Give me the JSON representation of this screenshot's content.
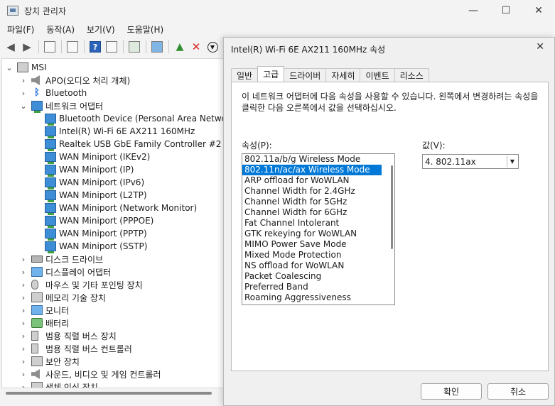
{
  "window": {
    "title": "장치 관리자",
    "minimize": "—",
    "maximize": "☐",
    "close": "✕"
  },
  "menu": [
    "파일(F)",
    "동작(A)",
    "보기(V)",
    "도움말(H)"
  ],
  "tree": {
    "root": "MSI",
    "categories": [
      {
        "label": "APO(오디오 처리 개체)",
        "icon": "speaker-icon"
      },
      {
        "label": "Bluetooth",
        "icon": "bluetooth-icon"
      },
      {
        "label": "네트워크 어댑터",
        "icon": "network-adapter-icon",
        "expanded": true
      }
    ],
    "network_adapters": [
      "Bluetooth Device (Personal Area Network)",
      "Intel(R) Wi-Fi 6E AX211 160MHz",
      "Realtek USB GbE Family Controller #2",
      "WAN Miniport (IKEv2)",
      "WAN Miniport (IP)",
      "WAN Miniport (IPv6)",
      "WAN Miniport (L2TP)",
      "WAN Miniport (Network Monitor)",
      "WAN Miniport (PPPOE)",
      "WAN Miniport (PPTP)",
      "WAN Miniport (SSTP)"
    ],
    "more_categories": [
      {
        "label": "디스크 드라이브",
        "icon": "disk-drive-icon"
      },
      {
        "label": "디스플레이 어댑터",
        "icon": "display-adapter-icon"
      },
      {
        "label": "마우스 및 기타 포인팅 장치",
        "icon": "mouse-icon"
      },
      {
        "label": "메모리 기술 장치",
        "icon": "memory-icon"
      },
      {
        "label": "모니터",
        "icon": "monitor-icon"
      },
      {
        "label": "배터리",
        "icon": "battery-icon"
      },
      {
        "label": "범용 직렬 버스 장치",
        "icon": "usb-device-icon"
      },
      {
        "label": "범용 직렬 버스 컨트롤러",
        "icon": "usb-controller-icon"
      },
      {
        "label": "보안 장치",
        "icon": "security-device-icon"
      },
      {
        "label": "사운드, 비디오 및 게임 컨트롤러",
        "icon": "sound-icon"
      },
      {
        "label": "생체 인식 장치",
        "icon": "biometric-icon"
      }
    ]
  },
  "dialog": {
    "title": "Intel(R) Wi-Fi 6E AX211 160MHz 속성",
    "close": "✕",
    "tabs": [
      "일반",
      "고급",
      "드라이버",
      "자세히",
      "이벤트",
      "리소스"
    ],
    "active_tab": "고급",
    "description": "이 네트워크 어댑터에 다음 속성을 사용할 수 있습니다. 왼쪽에서 변경하려는 속성을 클릭한 다음 오른쪽에서 값을 선택하십시오.",
    "property_label": "속성(P):",
    "value_label": "값(V):",
    "properties": [
      "802.11a/b/g Wireless Mode",
      "802.11n/ac/ax Wireless Mode",
      "ARP offload for WoWLAN",
      "Channel Width for 2.4GHz",
      "Channel Width for 5GHz",
      "Channel Width for 6GHz",
      "Fat Channel Intolerant",
      "GTK rekeying for WoWLAN",
      "MIMO Power Save Mode",
      "Mixed Mode Protection",
      "NS offload for WoWLAN",
      "Packet Coalescing",
      "Preferred Band",
      "Roaming Aggressiveness"
    ],
    "selected_property": "802.11n/ac/ax Wireless Mode",
    "value": "4. 802.11ax",
    "ok": "확인",
    "cancel": "취소"
  }
}
